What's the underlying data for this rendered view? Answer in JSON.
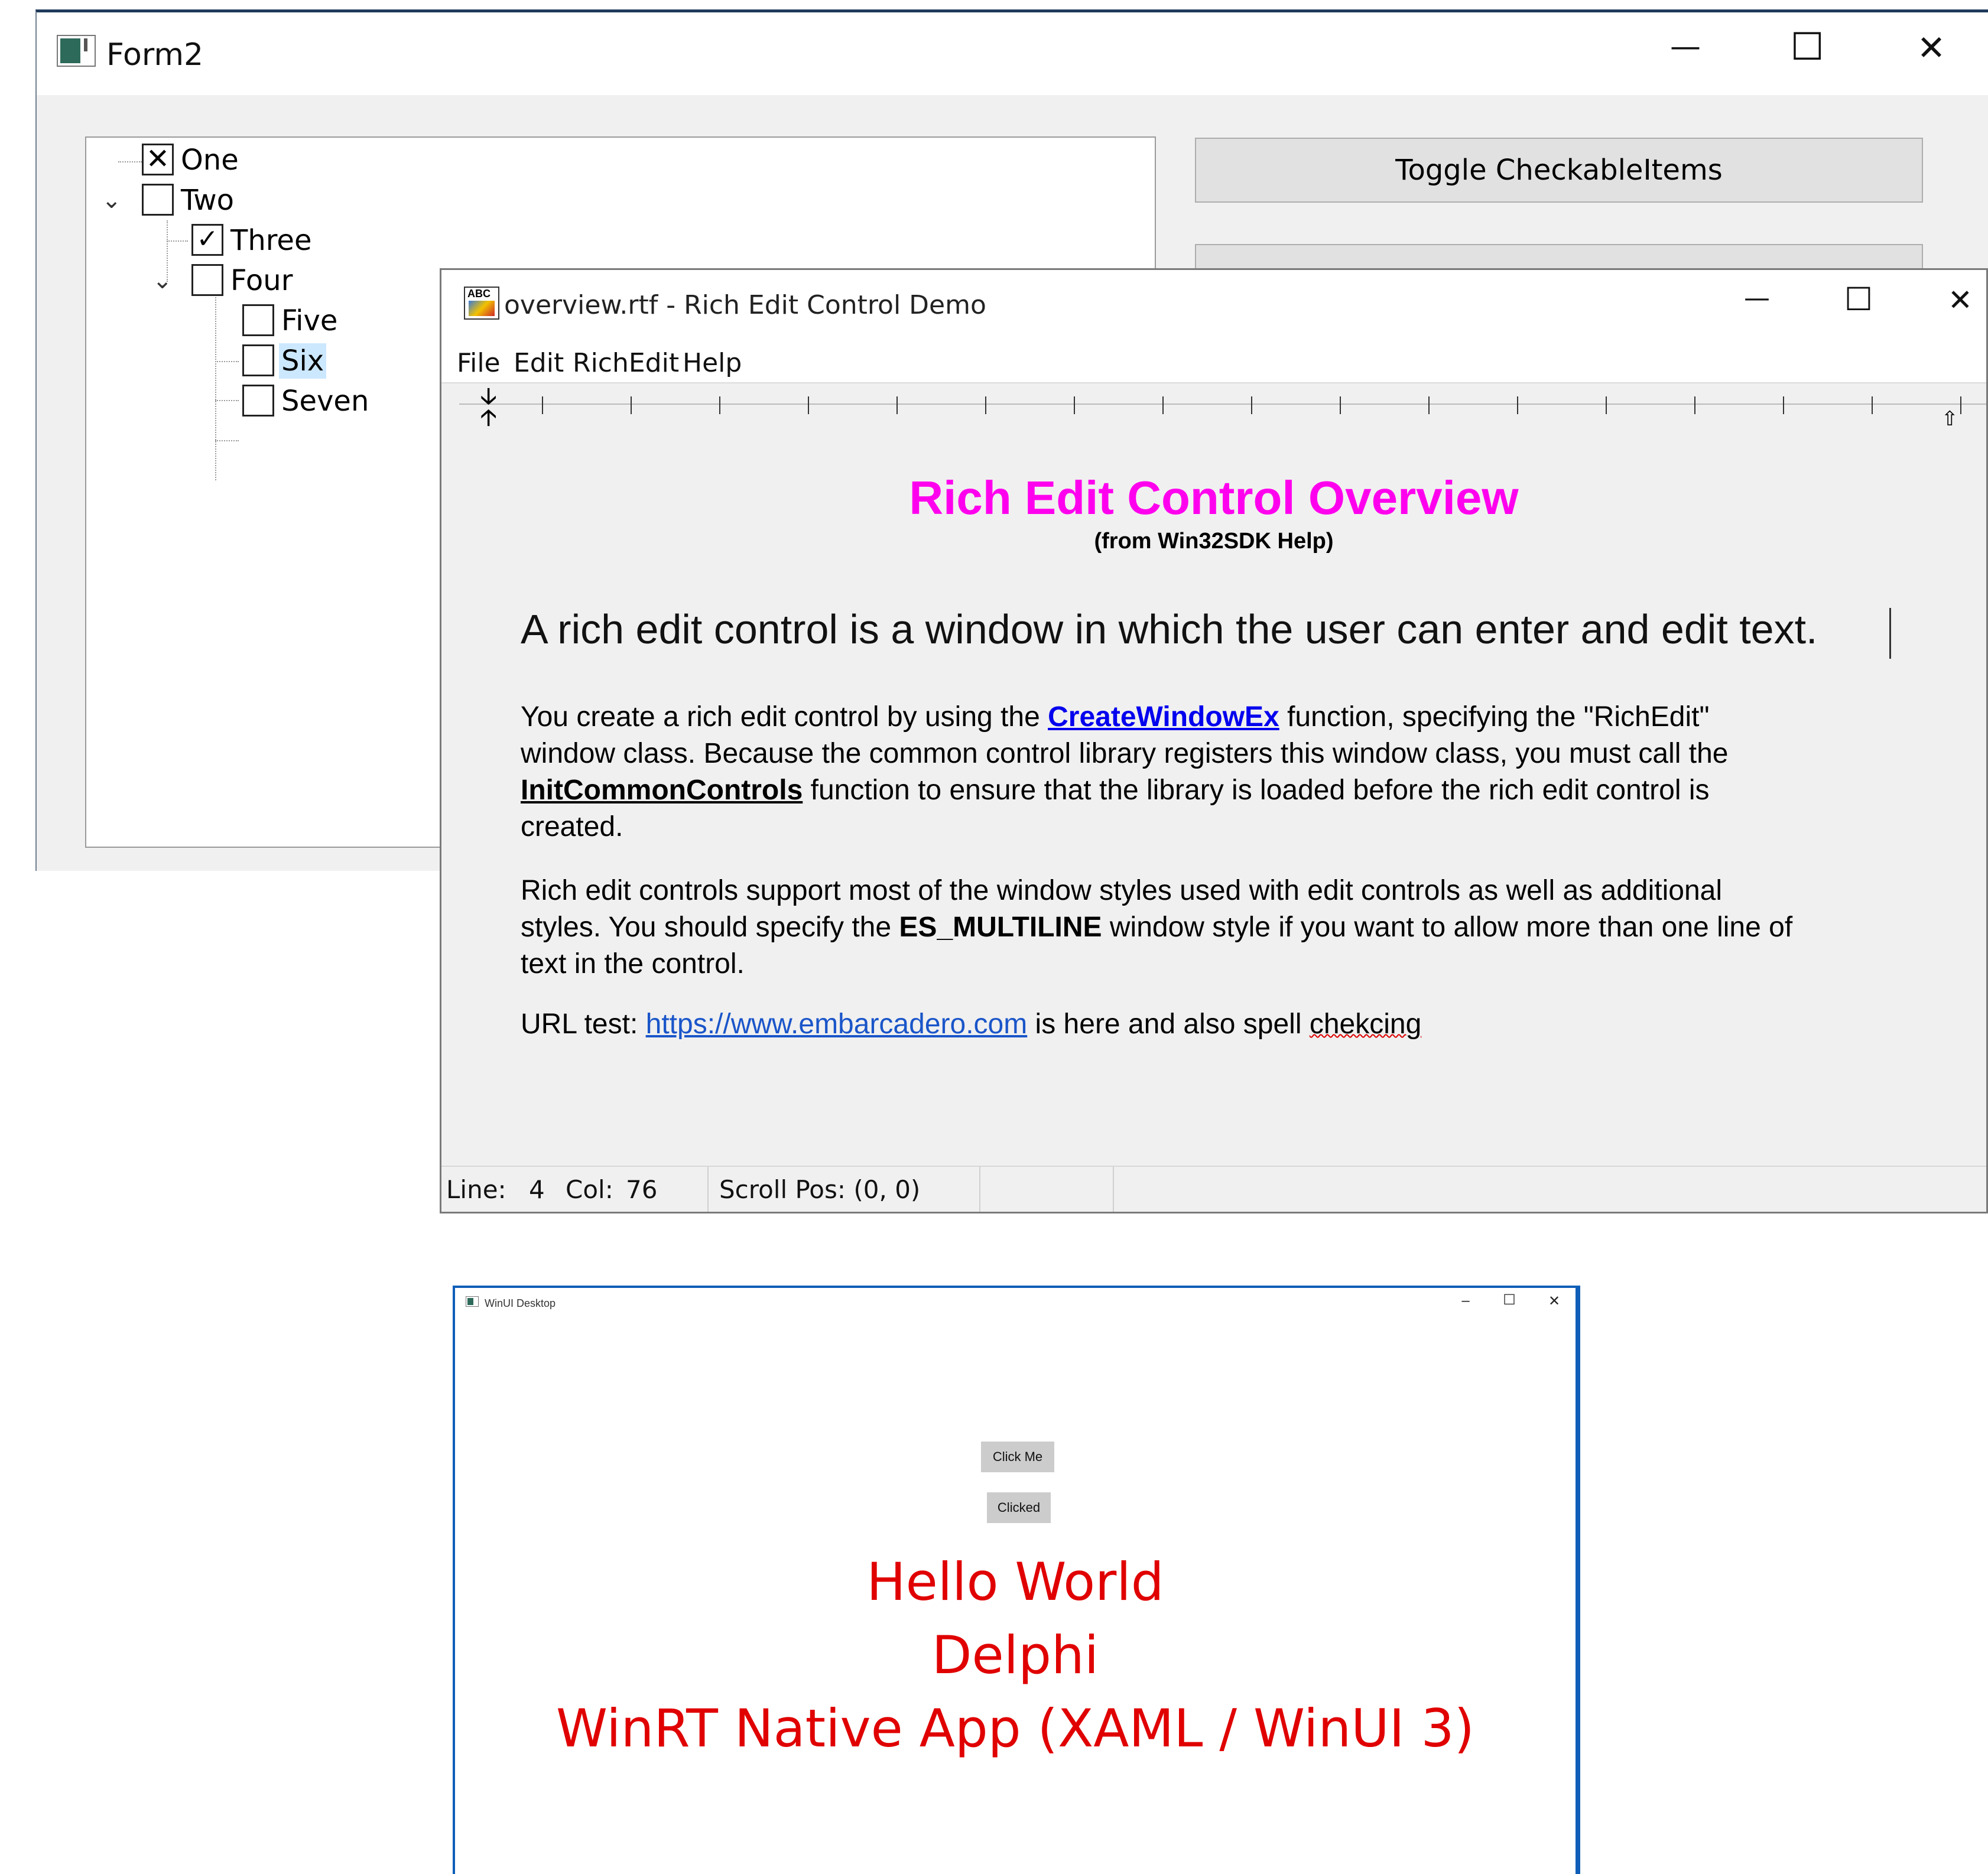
{
  "form2": {
    "title": "Form2",
    "controls": {
      "minimize": "—",
      "maximize": "☐",
      "close": "✕"
    },
    "tree": [
      {
        "label": "One",
        "check": "✕"
      },
      {
        "label": "Two",
        "check": ""
      },
      {
        "label": "Three",
        "check": "✓"
      },
      {
        "label": "Four",
        "check": ""
      },
      {
        "label": "Five",
        "check": ""
      },
      {
        "label": "Six",
        "check": ""
      },
      {
        "label": "Seven",
        "check": ""
      }
    ],
    "buttons": {
      "toggle_checkable": "Toggle CheckableItems"
    }
  },
  "rich": {
    "title": "overview.rtf - Rich Edit Control Demo",
    "controls": {
      "minimize": "—",
      "maximize": "☐",
      "close": "✕"
    },
    "menu": [
      "File",
      "Edit",
      "RichEdit",
      "Help"
    ],
    "doc": {
      "heading": "Rich Edit Control Overview",
      "subheading": "(from Win32SDK Help)",
      "intro": "A rich edit control is a window in which the user can enter and edit text.",
      "p1": {
        "a": "You create a rich edit control by using the ",
        "link1": "CreateWindowEx",
        "b": " function, specifying the \"RichEdit\"",
        "c": "window class. Because the common control library registers this window class, you must call the",
        "link2": "InitCommonControls",
        "d": " function to ensure that the library is loaded before the rich edit control is",
        "e": "created."
      },
      "p2": {
        "a": "Rich edit controls support most of the window styles used with edit controls as well as additional",
        "b": "styles. You should specify the ",
        "bold": "ES_MULTILINE",
        "c": " window style if you want to allow more than one line of",
        "d": "text in the control."
      },
      "p3": {
        "a": "URL test: ",
        "url": "https://www.embarcadero.com",
        "b": " is here and also spell ",
        "misspelled": "chekcing"
      }
    },
    "status": {
      "line_label": "Line:",
      "line_value": "4",
      "col_label": "Col:",
      "col_value": "76",
      "scroll": "Scroll Pos: (0, 0)"
    }
  },
  "winui": {
    "title": "WinUI Desktop",
    "controls": {
      "minimize": "–",
      "maximize": "☐",
      "close": "✕"
    },
    "buttons": {
      "click_me": "Click Me",
      "clicked": "Clicked"
    },
    "lines": [
      "Hello World",
      "Delphi",
      "WinRT Native App (XAML / WinUI 3)"
    ],
    "accent_color": "#e00000",
    "border_color": "#0f5fb8"
  }
}
